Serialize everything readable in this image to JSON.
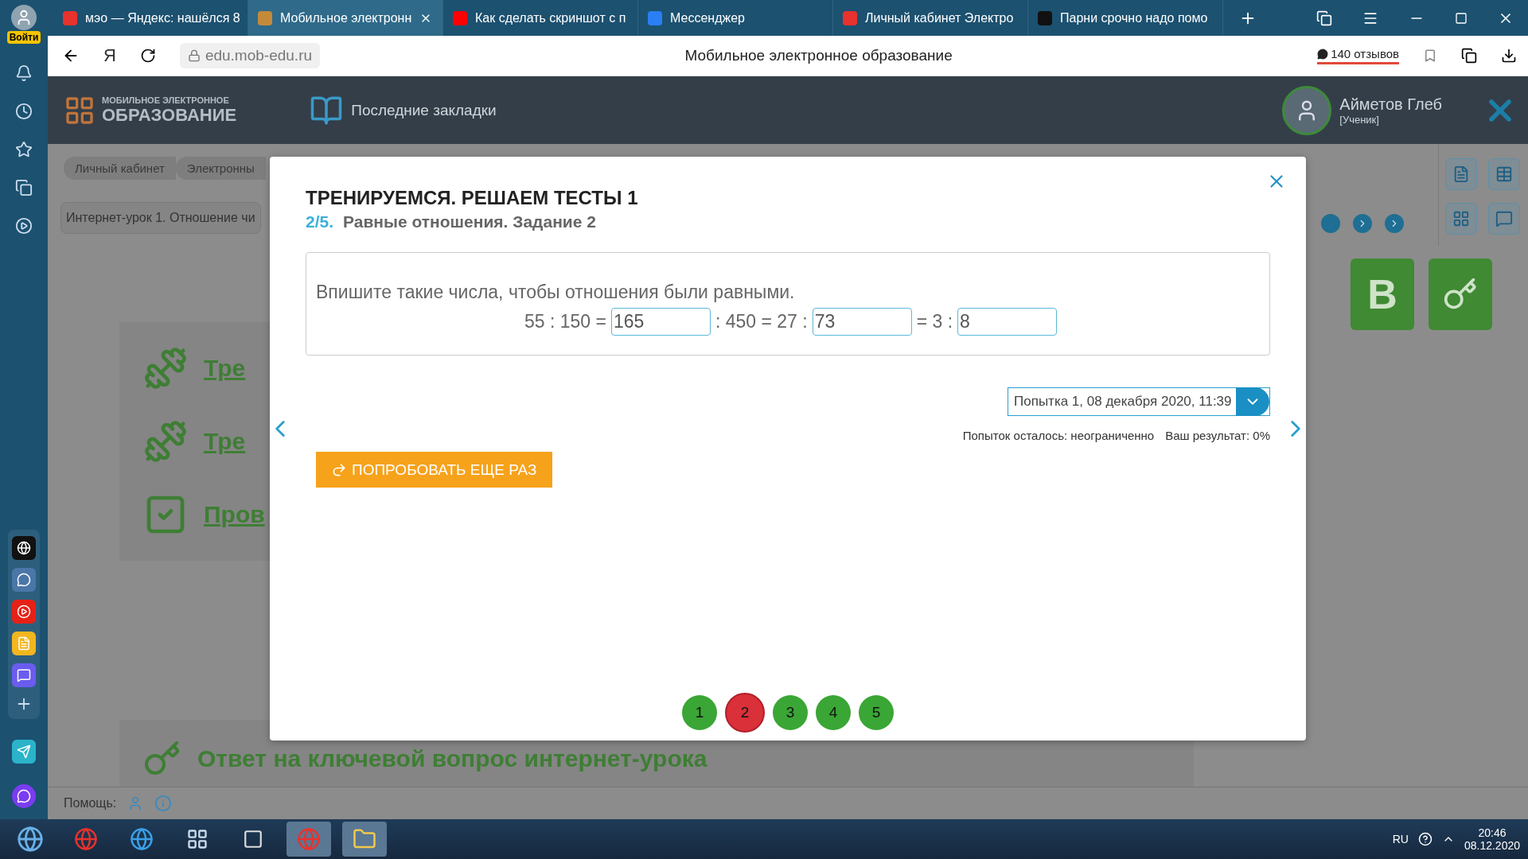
{
  "browser": {
    "login_label": "Войти",
    "tabs": [
      {
        "title": "мэо — Яндекс: нашёлся 8",
        "kind": "yandex",
        "selected": false
      },
      {
        "title": "Мобильное электронн",
        "kind": "site",
        "selected": true
      },
      {
        "title": "Как сделать скриншот с п",
        "kind": "video",
        "selected": false
      },
      {
        "title": "Мессенджер",
        "kind": "chat",
        "selected": false
      },
      {
        "title": "Личный кабинет Электро",
        "kind": "yandex",
        "selected": false
      },
      {
        "title": "Парни срочно надо помо",
        "kind": "dark",
        "selected": false
      }
    ],
    "home_glyph": "Я",
    "url": "edu.mob-edu.ru",
    "page_title": "Мобильное электронное образование",
    "reviews": "140 отзывов"
  },
  "site": {
    "logo_top": "МОБИЛЬНОЕ ЭЛЕКТРОННОЕ",
    "logo_bottom": "ОБРАЗОВАНИЕ",
    "bookmarks": "Последние закладки",
    "user_name": "Айметов Глеб",
    "user_role": "[Ученик]"
  },
  "breadcrumbs": [
    "Личный кабинет",
    "Электронны"
  ],
  "lesson_title": "Интернет-урок 1. Отношение чи",
  "lesson_items": [
    {
      "kind": "dumbbell",
      "label": "Тре"
    },
    {
      "kind": "dumbbell",
      "label": "Тре"
    },
    {
      "kind": "check",
      "label": "Пров"
    }
  ],
  "key_question": "Ответ на ключевой вопрос интернет-урока",
  "textbook_glyph": "В",
  "modal": {
    "title": "ТРЕНИРУЕМСЯ. РЕШАЕМ ТЕСТЫ 1",
    "progress": "2/5.",
    "subtitle": "Равные отношения. Задание 2",
    "instruction": "Впишите такие числа, чтобы отношения были равными.",
    "equation": [
      {
        "kind": "text",
        "text": "55 : 150 ="
      },
      {
        "kind": "input",
        "value": "165"
      },
      {
        "kind": "text",
        "text": ": 450 = 27 :"
      },
      {
        "kind": "input",
        "value": "73"
      },
      {
        "kind": "text",
        "text": "= 3 :"
      },
      {
        "kind": "input",
        "value": "8"
      }
    ],
    "attempt": "Попытка 1, 08 декабря 2020, 11:39",
    "attempts_left": "Попыток осталось: неограниченно",
    "result": "Ваш результат: 0%",
    "retry": "ПОПРОБОВАТЬ ЕЩЕ РАЗ",
    "pages": [
      {
        "label": "1",
        "selected": false,
        "color": "#3aa635"
      },
      {
        "label": "2",
        "selected": true,
        "color": "#d9303a"
      },
      {
        "label": "3",
        "selected": false,
        "color": "#3aa635"
      },
      {
        "label": "4",
        "selected": false,
        "color": "#3aa635"
      },
      {
        "label": "5",
        "selected": false,
        "color": "#3aa635"
      }
    ]
  },
  "help_label": "Помощь:",
  "taskbar": {
    "lang": "RU",
    "time": "20:46",
    "date": "08.12.2020"
  }
}
